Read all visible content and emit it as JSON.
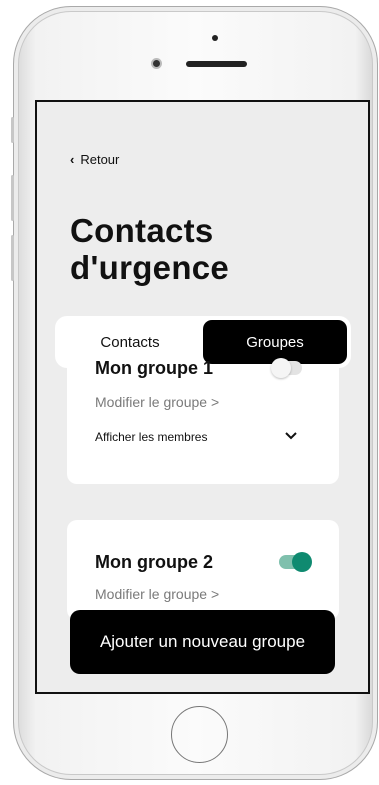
{
  "nav": {
    "back_label": "Retour"
  },
  "page": {
    "title_line1": "Contacts",
    "title_line2": "d'urgence"
  },
  "tabs": [
    {
      "label": "Contacts",
      "selected": false
    },
    {
      "label": "Groupes",
      "selected": true
    }
  ],
  "groups": [
    {
      "name": "Mon groupe 1",
      "edit_label": "Modifier le groupe >",
      "members_label": "Afficher les membres",
      "enabled": false
    },
    {
      "name": "Mon groupe 2",
      "edit_label": "Modifier le groupe >",
      "enabled": true
    }
  ],
  "actions": {
    "add_group_label": "Ajouter un nouveau groupe"
  },
  "colors": {
    "accent": "#0f8a70",
    "toggle_on_track": "#7fc0ad",
    "screen_bg": "#ededed",
    "primary_button": "#000000"
  },
  "icons": {
    "back": "chevron-left-icon",
    "expand": "chevron-down-icon"
  }
}
